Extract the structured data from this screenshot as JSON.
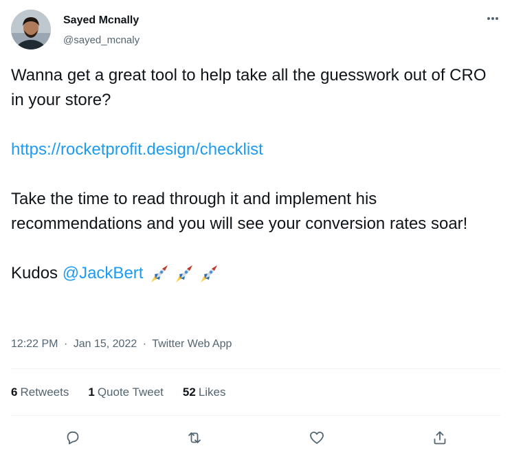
{
  "user": {
    "display_name": "Sayed Mcnally",
    "handle": "@sayed_mcnaly"
  },
  "tweet": {
    "line1": "Wanna get a great tool to help take all the guesswork out of CRO in your store?",
    "link": "https://rocketprofit.design/checklist",
    "line2": "Take the time to read through it and implement his recommendations and you will see your conversion rates soar!",
    "kudos_prefix": "Kudos ",
    "mention": "@JackBert",
    "emoji": "rocket-emoji"
  },
  "meta": {
    "time": "12:22 PM",
    "separator": "·",
    "date": "Jan 15, 2022",
    "source": "Twitter Web App"
  },
  "stats": {
    "retweets_count": "6",
    "retweets_label": "Retweets",
    "quotes_count": "1",
    "quotes_label": "Quote Tweet",
    "likes_count": "52",
    "likes_label": "Likes"
  },
  "icons": {
    "reply": "reply-icon",
    "retweet": "retweet-icon",
    "like": "heart-icon",
    "share": "share-icon",
    "more": "more-icon"
  },
  "colors": {
    "text": "#0f1419",
    "secondary": "#536471",
    "link": "#1d9bf0",
    "divider": "#eff3f4"
  }
}
